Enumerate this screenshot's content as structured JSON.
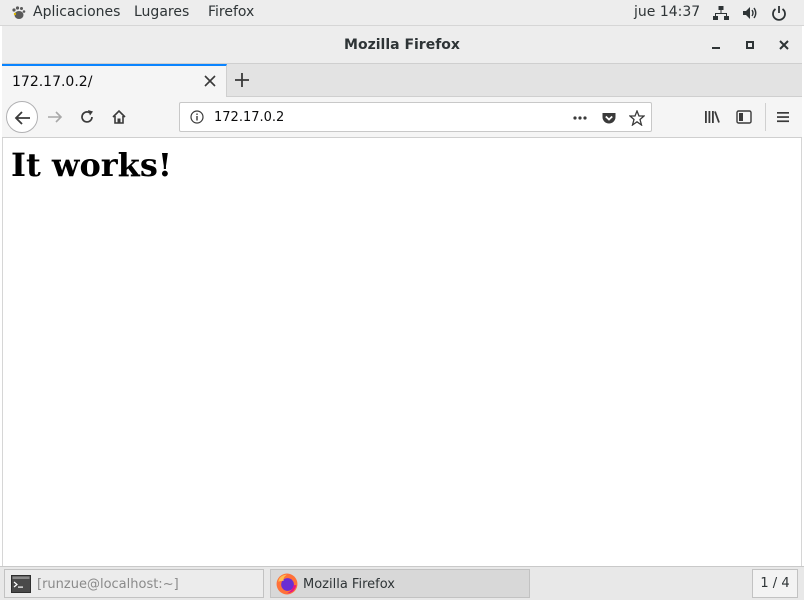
{
  "topbar": {
    "menu_apps": "Aplicaciones",
    "menu_places": "Lugares",
    "menu_firefox": "Firefox",
    "clock": "jue 14:37",
    "icons": [
      "network-icon",
      "volume-icon",
      "power-icon"
    ]
  },
  "window": {
    "title": "Mozilla Firefox"
  },
  "tabs": [
    {
      "label": "172.17.0.2/",
      "active": true
    }
  ],
  "urlbar": {
    "value": "172.17.0.2"
  },
  "page": {
    "heading": "It works!"
  },
  "taskbar": {
    "terminal_label": "[runzue@localhost:~]",
    "firefox_label": "Mozilla Firefox",
    "workspace": "1 / 4"
  },
  "colors": {
    "accent": "#0a84ff",
    "chrome_bg": "#f5f5f5",
    "panel_bg": "#ededed"
  }
}
